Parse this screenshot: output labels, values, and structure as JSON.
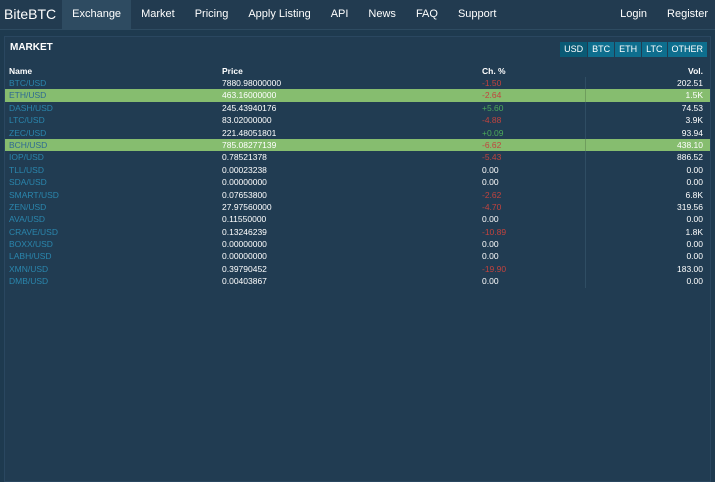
{
  "nav": {
    "brand": "BiteBTC",
    "items": [
      "Exchange",
      "Market",
      "Pricing",
      "Apply Listing",
      "API",
      "News",
      "FAQ",
      "Support"
    ],
    "active": "Exchange",
    "right_items": [
      "Login",
      "Register"
    ]
  },
  "market": {
    "title": "MARKET",
    "currency_tabs": [
      "USD",
      "BTC",
      "ETH",
      "LTC",
      "OTHER"
    ],
    "active_tab": "USD",
    "columns": {
      "name": "Name",
      "price": "Price",
      "change": "Ch. %",
      "vol": "Vol."
    },
    "rows": [
      {
        "pair": "BTC/USD",
        "price": "7880.98000000",
        "change": "-1.50",
        "change_dir": "neg",
        "vol": "202.51",
        "highlighted": false
      },
      {
        "pair": "ETH/USD",
        "price": "463.16000000",
        "change": "-2.64",
        "change_dir": "neg",
        "vol": "1.5K",
        "highlighted": true
      },
      {
        "pair": "DASH/USD",
        "price": "245.43940176",
        "change": "+5.60",
        "change_dir": "pos",
        "vol": "74.53",
        "highlighted": false
      },
      {
        "pair": "LTC/USD",
        "price": "83.02000000",
        "change": "-4.88",
        "change_dir": "neg",
        "vol": "3.9K",
        "highlighted": false
      },
      {
        "pair": "ZEC/USD",
        "price": "221.48051801",
        "change": "+0.09",
        "change_dir": "pos",
        "vol": "93.94",
        "highlighted": false
      },
      {
        "pair": "BCH/USD",
        "price": "785.08277139",
        "change": "-6.62",
        "change_dir": "neg",
        "vol": "438.10",
        "highlighted": true
      },
      {
        "pair": "IOP/USD",
        "price": "0.78521378",
        "change": "-5.43",
        "change_dir": "neg",
        "vol": "886.52",
        "highlighted": false
      },
      {
        "pair": "TLL/USD",
        "price": "0.00023238",
        "change": "0.00",
        "change_dir": "neutral",
        "vol": "0.00",
        "highlighted": false
      },
      {
        "pair": "SDA/USD",
        "price": "0.00000000",
        "change": "0.00",
        "change_dir": "neutral",
        "vol": "0.00",
        "highlighted": false
      },
      {
        "pair": "SMART/USD",
        "price": "0.07653800",
        "change": "-2.62",
        "change_dir": "neg",
        "vol": "6.8K",
        "highlighted": false
      },
      {
        "pair": "ZEN/USD",
        "price": "27.97560000",
        "change": "-4.70",
        "change_dir": "neg",
        "vol": "319.56",
        "highlighted": false
      },
      {
        "pair": "AVA/USD",
        "price": "0.11550000",
        "change": "0.00",
        "change_dir": "neutral",
        "vol": "0.00",
        "highlighted": false
      },
      {
        "pair": "CRAVE/USD",
        "price": "0.13246239",
        "change": "-10.89",
        "change_dir": "neg",
        "vol": "1.8K",
        "highlighted": false
      },
      {
        "pair": "BOXX/USD",
        "price": "0.00000000",
        "change": "0.00",
        "change_dir": "neutral",
        "vol": "0.00",
        "highlighted": false
      },
      {
        "pair": "LABH/USD",
        "price": "0.00000000",
        "change": "0.00",
        "change_dir": "neutral",
        "vol": "0.00",
        "highlighted": false
      },
      {
        "pair": "XMN/USD",
        "price": "0.39790452",
        "change": "-19.90",
        "change_dir": "neg",
        "vol": "183.00",
        "highlighted": false
      },
      {
        "pair": "DMB/USD",
        "price": "0.00403867",
        "change": "0.00",
        "change_dir": "neutral",
        "vol": "0.00",
        "highlighted": false
      }
    ]
  },
  "colors": {
    "background": "#1e3a4f",
    "panel": "#213c52",
    "highlight_row": "#86bd6f",
    "tab_active": "#0a5a75",
    "tab": "#0e6e8e",
    "pair_link": "#2a86ad",
    "positive": "#4caa5a",
    "negative": "#c2433e"
  }
}
